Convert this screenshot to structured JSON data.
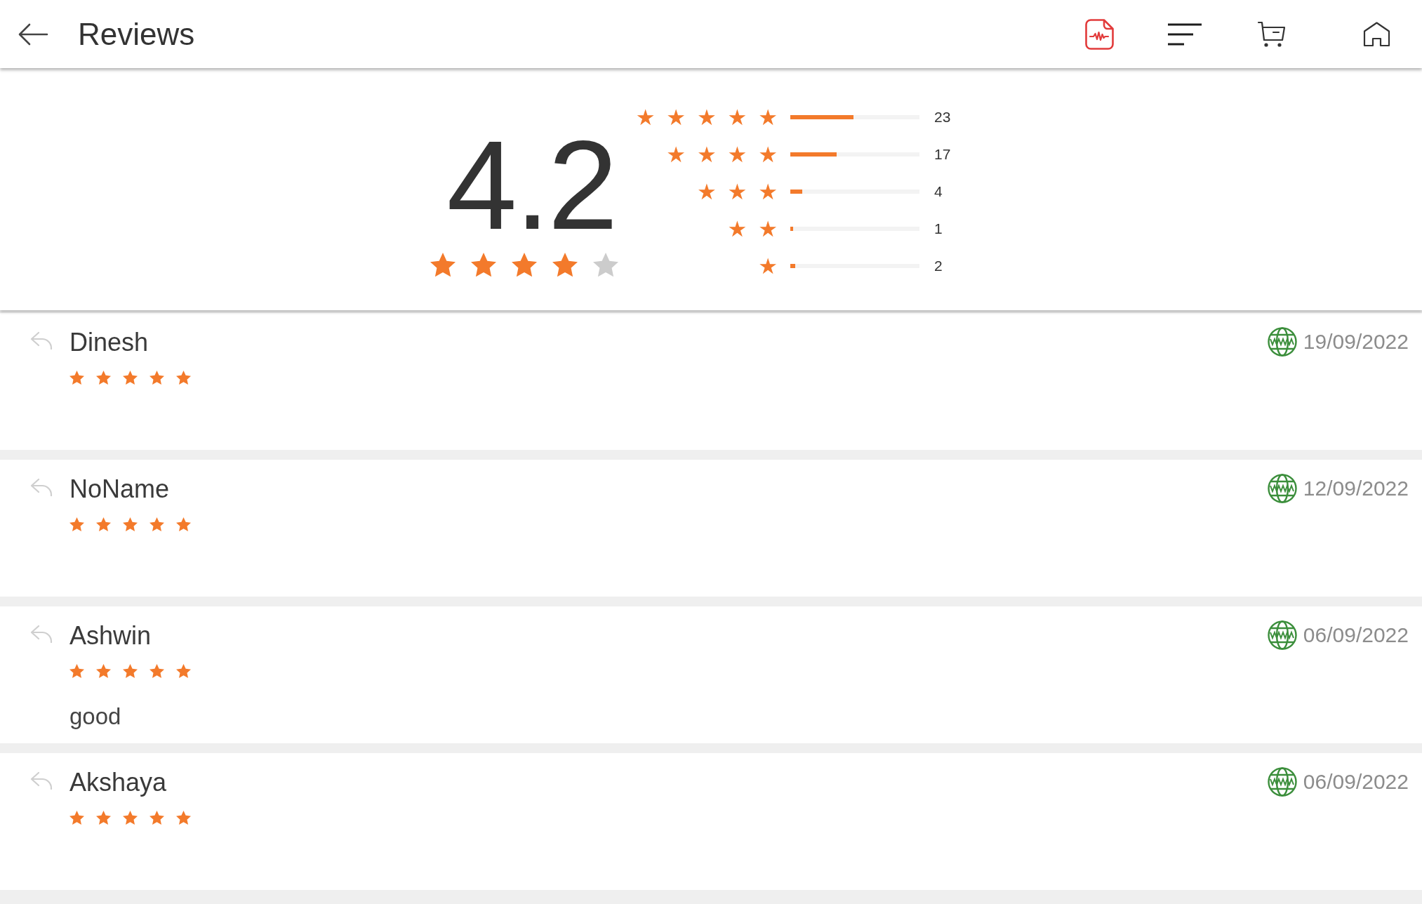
{
  "header": {
    "title": "Reviews"
  },
  "summary": {
    "average": "4.2",
    "stars": 4,
    "distribution": [
      {
        "label": "★ ★ ★ ★ ★",
        "level": 0.49,
        "count": "23"
      },
      {
        "label": "★ ★ ★ ★",
        "level": 0.36,
        "count": "17"
      },
      {
        "label": "★ ★ ★",
        "level": 0.09,
        "count": "4"
      },
      {
        "label": "★ ★",
        "level": 0.02,
        "count": "1"
      },
      {
        "label": "★",
        "level": 0.04,
        "count": "2"
      }
    ]
  },
  "reviews": [
    {
      "name": "Dinesh",
      "stars": 5,
      "date": "19/09/2022"
    },
    {
      "name": "NoName",
      "stars": 5,
      "date": "12/09/2022"
    },
    {
      "name": "Ashwin",
      "stars": 5,
      "date": "06/09/2022",
      "comment": "good"
    },
    {
      "name": "Akshaya",
      "stars": 5,
      "date": "06/09/2022"
    }
  ]
}
